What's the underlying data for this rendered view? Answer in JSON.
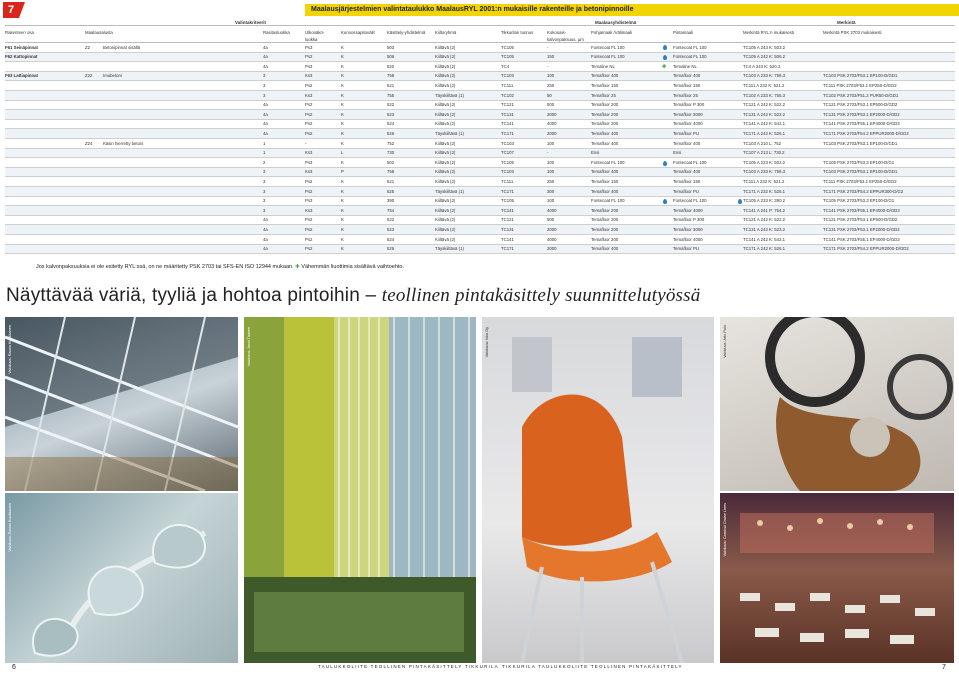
{
  "page_badge": "7",
  "banner_title": "Maalausjärjestelmien valintataulukko MaalausRYL 2001:n mukaisille rakenteille ja betonipinnoille",
  "groups": {
    "valinta": "Valintakriteerit",
    "maalaus": "Maalausyhdistelmä",
    "merkinta": "Merkintä"
  },
  "headers": {
    "rakenteen_osa": "Rakenteen osa",
    "maalausalusta": "Maalausalusta",
    "rasitusluokka": "Rasitusluokka",
    "ulkonako": "Ulkonäkö-\nluokka",
    "kunnossapito": "Kunnossapitovälit",
    "kasittely": "Käsittely-yhdistelmä",
    "kiiltoryhma": "Kiiltoryhmä",
    "tunnus": "Tikkurilan tunnus",
    "kalvo": "Kokonais-\nkalvonpaksuus, µm",
    "pohja": "Pohjamaali /Välimaali",
    "pinta": "Pintamaali",
    "ryl": "Merkintä RYL:n mukaisesti",
    "psk": "Merkintä PSK 2703 mukaisesti"
  },
  "rows": [
    {
      "osa": "F61 Seinäpinnat",
      "alusta": "Z2",
      "alusta_name": "Betonipinnat sisällä",
      "ras": "4a",
      "ulk": "Ps3",
      "kun": "K",
      "kas": "503",
      "kii": "Kiiltävä (2)",
      "tun": "TC105",
      "kal": "-",
      "poh": "Fontecoat FL 100",
      "poh_drop": true,
      "pin": "Fontecoat FL 100",
      "pin_drop": false,
      "ryl": "TC105 A 243 K: 503.2",
      "psk": ""
    },
    {
      "osa": "F62 Kattopinnat",
      "alusta": "",
      "alusta_name": "",
      "ras": "4a",
      "ulk": "Ps2",
      "kun": "K",
      "kas": "506",
      "kii": "Kiiltävä (2)",
      "tun": "TC105",
      "kal": "150",
      "poh": "Fontecoat FL 100",
      "poh_drop": true,
      "pin": "Fontecoat FL 100",
      "pin_drop": false,
      "ryl": "TC105 A 242 K: 506.2",
      "psk": ""
    },
    {
      "osa": "",
      "alusta": "",
      "alusta_name": "",
      "ras": "4a",
      "ulk": "Ps3",
      "kun": "K",
      "kas": "520",
      "kii": "Kiiltävä (2)",
      "tun": "TC4",
      "kal": "-",
      "poh": "Temaline NL",
      "poh_plus": true,
      "pin": "Temaline NL",
      "pin_drop": false,
      "ryl": "TC4 A 243 K: 520.2",
      "psk": ""
    },
    {
      "osa": "F63 Lattiapinnat",
      "alusta": "Z22",
      "alusta_name": "Imubetoni",
      "ras": "3",
      "ulk": "Ks3",
      "kun": "K",
      "kas": "758",
      "kii": "Kiiltävä (2)",
      "tun": "TC103",
      "kal": "100",
      "poh": "Temafloor 400",
      "pin": "Temafloor 400",
      "ryl": "TC103 A 233 K: 758.3",
      "psk": "TC103 PSK 2703/F53.1 EP100-D/GD1"
    },
    {
      "osa": "",
      "alusta": "",
      "alusta_name": "",
      "ras": "3",
      "ulk": "Ps2",
      "kun": "K",
      "kas": "521",
      "kii": "Kiiltävä (2)",
      "tun": "TC111",
      "kal": "250",
      "poh": "Temafloor 150",
      "pin": "Temafloor 150",
      "ryl": "TC111 A 232 K: 521.2",
      "psk": "TC111 PSK 2703/F53.1 EP250-D/GD2"
    },
    {
      "osa": "",
      "alusta": "",
      "alusta_name": "",
      "ras": "3",
      "ulk": "Ks3",
      "kun": "K",
      "kas": "755",
      "kii": "Täyskiiltävä (1)",
      "tun": "TC102",
      "kal": "50",
      "poh": "Temafloor 25",
      "pin": "Temafloor 25",
      "ryl": "TC102 A 233 K: 755.3",
      "psk": "TC102 PSK 2703/F51.2 PUR50-D/GD1"
    },
    {
      "osa": "",
      "alusta": "",
      "alusta_name": "",
      "ras": "4a",
      "ulk": "Ps2",
      "kun": "K",
      "kas": "522",
      "kii": "Kiiltävä (2)",
      "tun": "TC121",
      "kal": "500",
      "poh": "Temafloor 200",
      "pin": "Temafloor P 300",
      "ryl": "TC121 A 242 K: 522.2",
      "psk": "TC121 PSK 2703/F53.1 EP500-D/GD2"
    },
    {
      "osa": "",
      "alusta": "",
      "alusta_name": "",
      "ras": "4a",
      "ulk": "Ps2",
      "kun": "K",
      "kas": "523",
      "kii": "Kiiltävä (2)",
      "tun": "TC131",
      "kal": "2000",
      "poh": "Temafloor 200",
      "pin": "Temafloor 3000",
      "ryl": "TC131 A 242 K: 523.2",
      "psk": "TC131 PSK 2703/F53.1 EP2000-D/GD2"
    },
    {
      "osa": "",
      "alusta": "",
      "alusta_name": "",
      "ras": "4a",
      "ulk": "Ps2",
      "kun": "K",
      "kas": "524",
      "kii": "Kiiltävä (2)",
      "tun": "TC141",
      "kal": "4000",
      "poh": "Temafloor 200",
      "pin": "Temafloor 4000",
      "ryl": "TC141 A 242 K: 542.1",
      "psk": "TC141 PSK 2703/F55.1 EP4000-D/GD3"
    },
    {
      "osa": "",
      "alusta": "",
      "alusta_name": "",
      "ras": "4a",
      "ulk": "Ps2",
      "kun": "K",
      "kas": "526",
      "kii": "Täyskiiltävä (1)",
      "tun": "TC171",
      "kal": "2000",
      "poh": "Temafloor 400",
      "pin": "Temafloor PU",
      "ryl": "TC171 A 242 K: 526.1",
      "psk": "TC171 PSK 2703/F54.2 EPPUR2000-D/GD2"
    },
    {
      "osa": "",
      "alusta": "Z24",
      "alusta_name": "Käsin hierretty betoni",
      "ras": "1",
      "ulk": "-",
      "kun": "K",
      "kas": "752",
      "kii": "Kiiltävä (2)",
      "tun": "TC103",
      "kal": "100",
      "poh": "Temafloor 400",
      "pin": "Temafloor 400",
      "ryl": "TC103 A 210 L: 752",
      "psk": "TC103 PSK 2703/F53.1 EP100-D/GD1"
    },
    {
      "osa": "",
      "alusta": "",
      "alusta_name": "",
      "ras": "1",
      "ulk": "Ks3",
      "kun": "L",
      "kas": "730",
      "kii": "Kiiltävä (2)",
      "tun": "TC107",
      "kal": "-",
      "poh": "Ensi",
      "pin": "Ensi",
      "ryl": "TC107 A 213 L: 730.2",
      "psk": ""
    },
    {
      "osa": "",
      "alusta": "",
      "alusta_name": "",
      "ras": "2",
      "ulk": "Ps3",
      "kun": "K",
      "kas": "502",
      "kii": "Kiiltävä (2)",
      "tun": "TC105",
      "kal": "100",
      "poh": "Fontecoat FL 100",
      "poh_drop": true,
      "pin": "Fontecoat FL 100",
      "ryl": "TC105 A 223 K: 502.2",
      "psk": "TC105 PSK 2703/F53.3 EP100-D/G1"
    },
    {
      "osa": "",
      "alusta": "",
      "alusta_name": "",
      "ras": "3",
      "ulk": "Ks3",
      "kun": "P",
      "kas": "758",
      "kii": "Kiiltävä (2)",
      "tun": "TC103",
      "kal": "100",
      "poh": "Temafloor 400",
      "pin": "Temafloor 400",
      "ryl": "TC103 A 233 K: 758.3",
      "psk": "TC103 PSK 2703/F53.1 EP100-D/GD1"
    },
    {
      "osa": "",
      "alusta": "",
      "alusta_name": "",
      "ras": "3",
      "ulk": "Ps2",
      "kun": "K",
      "kas": "521",
      "kii": "Kiiltävä (2)",
      "tun": "TC111",
      "kal": "250",
      "poh": "Temafloor 150",
      "pin": "Temafloor 150",
      "ryl": "TC111 A 232 K: 521.2",
      "psk": "TC111 PSK 2703/F53.1 EP250-D/GD2"
    },
    {
      "osa": "",
      "alusta": "",
      "alusta_name": "",
      "ras": "3",
      "ulk": "Ps2",
      "kun": "K",
      "kas": "525",
      "kii": "Täyskiiltävä (1)",
      "tun": "TC171",
      "kal": "300",
      "poh": "Temafloor 400",
      "pin": "Temafloor PU",
      "ryl": "TC171 A 232 K: 525.1",
      "psk": "TC171 PSK 2703/F54.2 EPPUR300-D/G2"
    },
    {
      "osa": "",
      "alusta": "",
      "alusta_name": "",
      "ras": "3",
      "ulk": "Ps3",
      "kun": "K",
      "kas": "390",
      "kii": "Kiiltävä (2)",
      "tun": "TC105",
      "kal": "100",
      "poh": "Fontecoat FL 100",
      "poh_drop": true,
      "pin": "Fontecoat FL 100",
      "pin_drop": true,
      "ryl": "TC105 A 233 K: 390.2",
      "psk": "TC105 PSK 2703/F53.3 EP100-D/G1"
    },
    {
      "osa": "",
      "alusta": "",
      "alusta_name": "",
      "ras": "3",
      "ulk": "Ks3",
      "kun": "K",
      "kas": "754",
      "kii": "Kiiltävä (2)",
      "tun": "TC141",
      "kal": "4000",
      "poh": "Temafloor 200",
      "pin": "Temafloor 4000",
      "ryl": "TC141 A 241 P: 754.2",
      "psk": "TC141 PSK 2703/F55.1 EP4000-D/GD3"
    },
    {
      "osa": "",
      "alusta": "",
      "alusta_name": "",
      "ras": "4a",
      "ulk": "Ps2",
      "kun": "K",
      "kas": "522",
      "kii": "Kiiltävä (2)",
      "tun": "TC121",
      "kal": "500",
      "poh": "Temafloor 200",
      "pin": "Temafloor P 300",
      "ryl": "TC121 A 242 K: 522.2",
      "psk": "TC121 PSK 2703/F53.1 EP500-D/GD2"
    },
    {
      "osa": "",
      "alusta": "",
      "alusta_name": "",
      "ras": "4a",
      "ulk": "Ps2",
      "kun": "K",
      "kas": "523",
      "kii": "Kiiltävä (2)",
      "tun": "TC131",
      "kal": "2000",
      "poh": "Temafloor 200",
      "pin": "Temafloor 3000",
      "ryl": "TC131 A 242 K: 523.2",
      "psk": "TC131 PSK 2703/F53.1 EP2000-D/GD2"
    },
    {
      "osa": "",
      "alusta": "",
      "alusta_name": "",
      "ras": "4a",
      "ulk": "Ps2",
      "kun": "K",
      "kas": "524",
      "kii": "Kiiltävä (2)",
      "tun": "TC141",
      "kal": "4000",
      "poh": "Temafloor 200",
      "pin": "Temafloor 4000",
      "ryl": "TC141 A 242 K: 542.1",
      "psk": "TC141 PSK 2703/F55.1 EP4000-D/GD3"
    },
    {
      "osa": "",
      "alusta": "",
      "alusta_name": "",
      "ras": "4a",
      "ulk": "Ps2",
      "kun": "K",
      "kas": "526",
      "kii": "Täyskiiltävä (1)",
      "tun": "TC171",
      "kal": "2000",
      "poh": "Temafloor 400",
      "pin": "Temafloor PU",
      "ryl": "TC171 A 242 K: 526.1",
      "psk": "TC171 PSK 2703/F54.2 EPPUR2000-D/GD2"
    }
  ],
  "footnote": "Jos kalvonpaksuuksia ei ole esitetty RYL:ssä, on ne määritetty PSK 2703 tai SFS-EN ISO 12944 mukaan.",
  "footnote_plus": "✚",
  "footnote_tail": "Vähemmän liuottimia sisältävä vaihtoehto.",
  "headline_main": "Näyttävää väriä, tyyliä ja hohtoa pintoihin",
  "headline_dash": "–",
  "headline_italic": "teollinen pintakäsittely suunnittelutyössä",
  "credits": {
    "p1": "Valokuva: Rauno Kuokkanen",
    "p2": "Valokuva: Jussi Tiainen",
    "p3": "Valokuva: Isku Oy",
    "p4": "Valokuva: Arto Palo",
    "p5": "Valokuva: Rauno Kuokkanen",
    "p6": "Valokuva: Carnival Cruise Lines"
  },
  "footer": {
    "left_no": "6",
    "right_no": "7",
    "left_text": "TAULUKKOLIITE TEOLLINEN PINTAKÄSITTELY TIKKURILA",
    "right_text": "TIKKURILA TAULUKKOLIITE TEOLLINEN PINTAKÄSITTELY"
  }
}
